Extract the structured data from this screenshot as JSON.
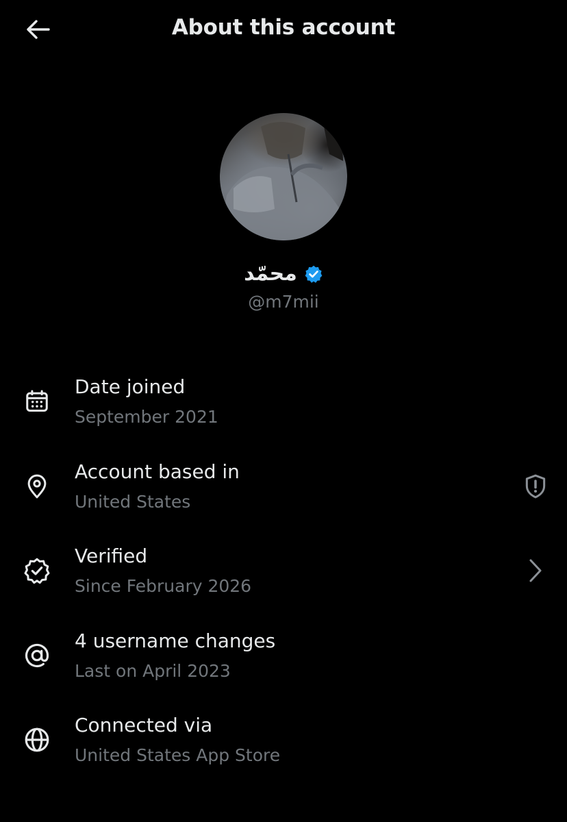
{
  "header": {
    "title": "About this account",
    "back_icon": "arrow-left-icon"
  },
  "profile": {
    "display_name": "محمّد",
    "handle": "@m7mii",
    "verified_color": "#1d9bf0"
  },
  "rows": [
    {
      "title": "Date joined",
      "subtitle": "September 2021",
      "icon": "calendar-icon"
    },
    {
      "title": "Account based in",
      "subtitle": "United States",
      "icon": "location-pin-icon",
      "trailing_icon": "shield-alert-icon"
    },
    {
      "title": "Verified",
      "subtitle": "Since February 2026",
      "icon": "verified-badge-outline-icon",
      "trailing_icon": "chevron-right-icon"
    },
    {
      "title": "4 username changes",
      "subtitle": "Last on April 2023",
      "icon": "at-sign-icon"
    },
    {
      "title": "Connected via",
      "subtitle": "United States App Store",
      "icon": "globe-icon"
    }
  ],
  "colors": {
    "background": "#000000",
    "primary_text": "#e7e9ea",
    "secondary_text": "#71767b",
    "accent": "#1d9bf0"
  }
}
